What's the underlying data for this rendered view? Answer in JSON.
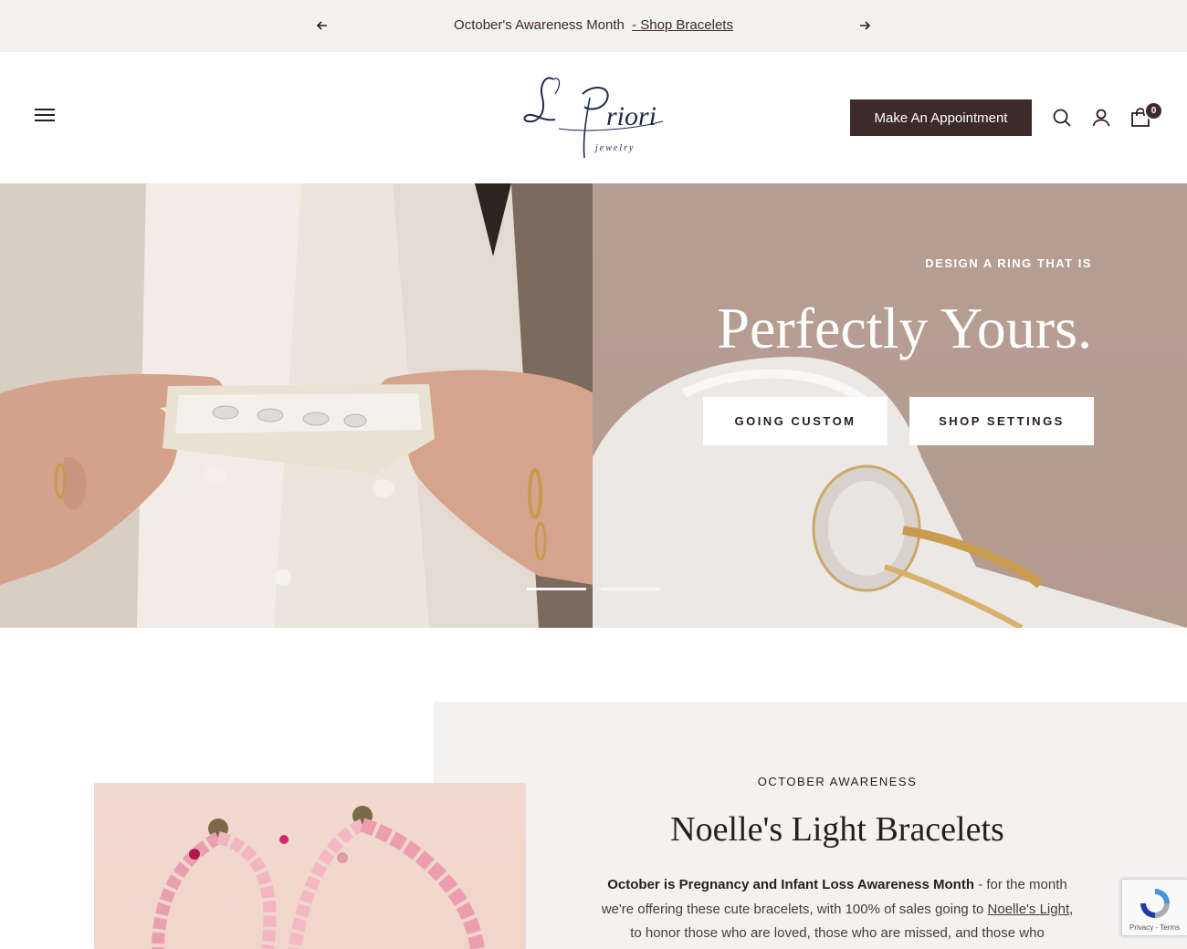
{
  "announcement": {
    "message": "October's Awareness Month",
    "link": "- Shop Bracelets"
  },
  "header": {
    "logo_text": "LPriori",
    "logo_sub": "jewelry",
    "appointment_label": "Make An Appointment",
    "cart_count": "0",
    "icons": [
      "menu-icon",
      "search-icon",
      "account-icon",
      "cart-icon"
    ]
  },
  "hero": {
    "eyebrow": "DESIGN A RING THAT IS",
    "title": "Perfectly Yours.",
    "buttons": [
      "GOING CUSTOM",
      "SHOP SETTINGS"
    ],
    "slides": 2,
    "active_slide": 1
  },
  "feature": {
    "eyebrow": "OCTOBER AWARENESS",
    "title": "Noelle's Light Bracelets",
    "text_bold": "October is Pregnancy and Infant Loss Awareness Month",
    "text_1": " - for the month we're offering these cute bracelets, with 100% of sales going to ",
    "text_link": "Noelle's Light",
    "text_2": ", to honor those who are loved, those who are missed, and those who"
  },
  "recaptcha": {
    "label": "Privacy - Terms"
  },
  "colors": {
    "accent": "#3d2b2b",
    "announcement_bg": "#f4f1f1",
    "hero_right_bg": "#b79e93",
    "logo": "#1d2a4d"
  }
}
